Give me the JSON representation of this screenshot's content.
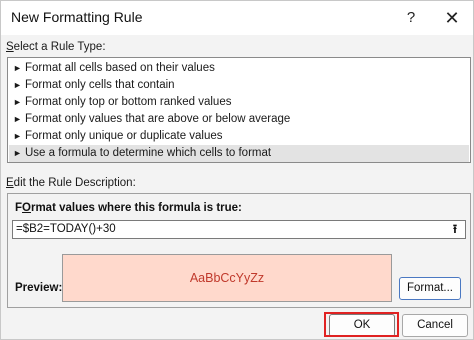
{
  "window": {
    "title": "New Formatting Rule",
    "help_glyph": "?",
    "close_glyph": "✕"
  },
  "rule_type": {
    "label_prefix": "S",
    "label_rest": "elect a Rule Type:",
    "items": [
      {
        "label": "Format all cells based on their values"
      },
      {
        "label": "Format only cells that contain"
      },
      {
        "label": "Format only top or bottom ranked values"
      },
      {
        "label": "Format only values that are above or below average"
      },
      {
        "label": "Format only unique or duplicate values"
      },
      {
        "label": "Use a formula to determine which cells to format"
      }
    ],
    "selected_index": 5
  },
  "description": {
    "label_prefix": "E",
    "label_rest": "dit the Rule Description:",
    "formula_heading_prefix": "O",
    "formula_heading_pre": "F",
    "formula_heading_rest": "rmat values where this formula is true:",
    "formula_value": "=$B2=TODAY()+30",
    "collapse_glyph": "⭱",
    "preview_label": "Preview:",
    "preview_text": "AaBbCcYyZz",
    "format_button": "Format..."
  },
  "footer": {
    "ok": "OK",
    "cancel": "Cancel"
  },
  "colors": {
    "preview_fill": "#ffd9cc",
    "preview_text": "#c0392b",
    "highlight": "#e02222"
  }
}
